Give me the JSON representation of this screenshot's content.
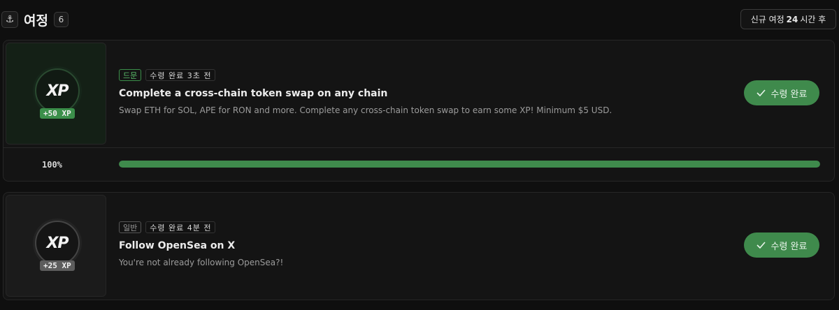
{
  "header": {
    "anchor_icon": "anchor-icon",
    "title": "여정",
    "count": "6",
    "new_journey_prefix": "신규 여정",
    "new_journey_hours": "24",
    "new_journey_suffix": "시간 후"
  },
  "colors": {
    "accent_green": "#3f8a4c",
    "background": "#0f0f0f",
    "card": "#141414"
  },
  "quests": [
    {
      "xp_logo": "XP",
      "xp_amount": "+50 XP",
      "type_tag": "드문",
      "status_tag": "수령 완료 3초 전",
      "title": "Complete a cross-chain token swap on any chain",
      "description": "Swap ETH for SOL, APE for RON and more. Complete any cross-chain token swap to earn some XP! Minimum $5 USD.",
      "button_label": "수령 완료",
      "progress_label": "100%",
      "progress_fraction": 1.0
    },
    {
      "xp_logo": "XP",
      "xp_amount": "+25 XP",
      "type_tag": "일반",
      "status_tag": "수령 완료 4분 전",
      "title": "Follow OpenSea on X",
      "description": "You're not already following OpenSea?!",
      "button_label": "수령 완료"
    }
  ]
}
